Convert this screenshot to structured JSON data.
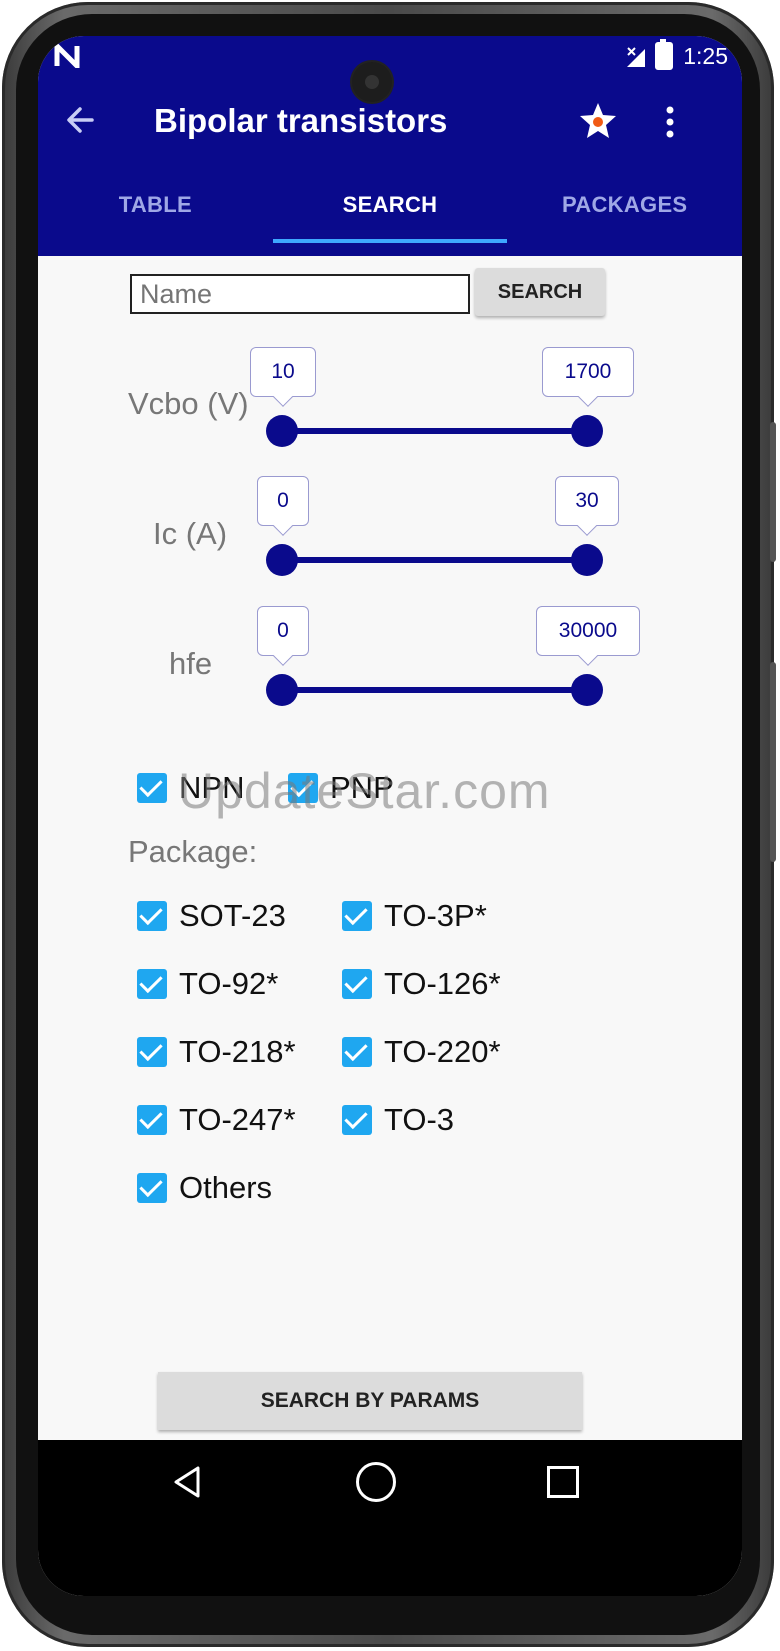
{
  "status_bar": {
    "left_icon": "n-logo-icon",
    "time": "1:25"
  },
  "app_bar": {
    "title": "Bipolar transistors"
  },
  "tabs": [
    {
      "label": "TABLE",
      "active": false
    },
    {
      "label": "SEARCH",
      "active": true
    },
    {
      "label": "PACKAGES",
      "active": false
    }
  ],
  "search": {
    "placeholder": "Name",
    "value": "",
    "button_label": "SEARCH"
  },
  "sliders": [
    {
      "label": "Vcbo (V)",
      "min_value": "10",
      "max_value": "1700"
    },
    {
      "label": "Ic (A)",
      "min_value": "0",
      "max_value": "30"
    },
    {
      "label": "hfe",
      "min_value": "0",
      "max_value": "30000"
    }
  ],
  "polarity": [
    {
      "label": "NPN",
      "checked": true
    },
    {
      "label": "PNP",
      "checked": true
    }
  ],
  "package_heading": "Package:",
  "packages": [
    {
      "label": "SOT-23",
      "checked": true
    },
    {
      "label": "TO-3P*",
      "checked": true
    },
    {
      "label": "TO-92*",
      "checked": true
    },
    {
      "label": "TO-126*",
      "checked": true
    },
    {
      "label": "TO-218*",
      "checked": true
    },
    {
      "label": "TO-220*",
      "checked": true
    },
    {
      "label": "TO-247*",
      "checked": true
    },
    {
      "label": "TO-3",
      "checked": true
    },
    {
      "label": "Others",
      "checked": true
    }
  ],
  "search_params_label": "SEARCH BY PARAMS",
  "watermark": "UpdateStar.com",
  "colors": {
    "primary": "#0a0a8c",
    "tab_indicator": "#3ea7ff",
    "checkbox": "#1fa7f0",
    "screen_bg": "#f8f8f8"
  }
}
